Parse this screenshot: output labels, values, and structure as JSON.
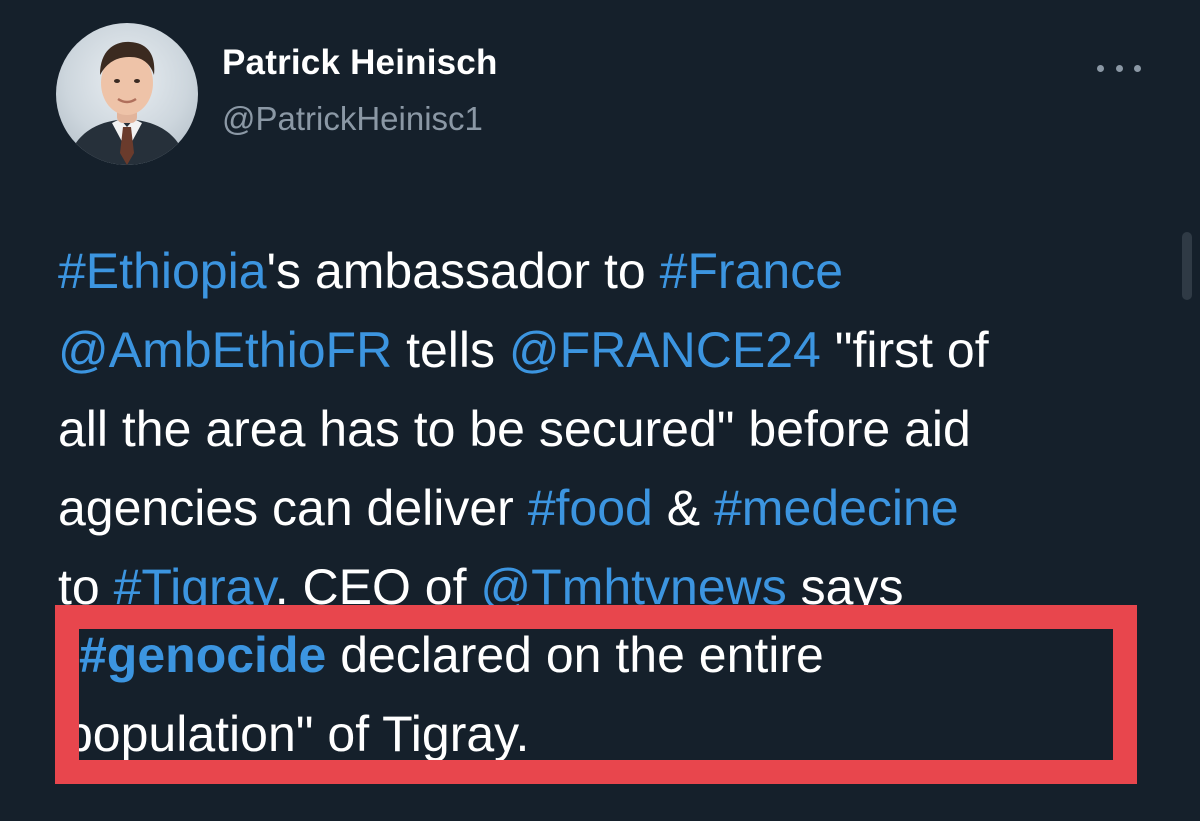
{
  "author": {
    "display_name": "Patrick Heinisch",
    "handle": "@PatrickHeinisc1"
  },
  "icons": {
    "more": "more-horizontal-icon",
    "avatar": "profile-photo"
  },
  "colors": {
    "background": "#15202b",
    "text": "#ffffff",
    "secondary_text": "#8b98a5",
    "link": "#3c95e0",
    "highlight_box": "#e8464d"
  },
  "tweet": {
    "line1": {
      "seg1": "#Ethiopia",
      "seg2": "'s ambassador to ",
      "seg3": "#France"
    },
    "line2": {
      "seg1": "@AmbEthioFR",
      "seg2": " tells ",
      "seg3": "@FRANCE24",
      "seg4": " \"first of"
    },
    "line3": {
      "seg1": "all the area has to be secured\" before aid"
    },
    "line4": {
      "seg1": "agencies can deliver ",
      "seg2": "#food",
      "seg3": " & ",
      "seg4": "#medecine"
    },
    "line5": {
      "seg1": "to ",
      "seg2": "#Tigray",
      "seg3": ". CEO of ",
      "seg4": "@Tmhtvnews",
      "seg5": " says"
    },
    "line6": {
      "seg1": "#genocide",
      "seg2": " declared on the entire"
    },
    "line7": {
      "seg1": "population\" of Tigray."
    }
  }
}
